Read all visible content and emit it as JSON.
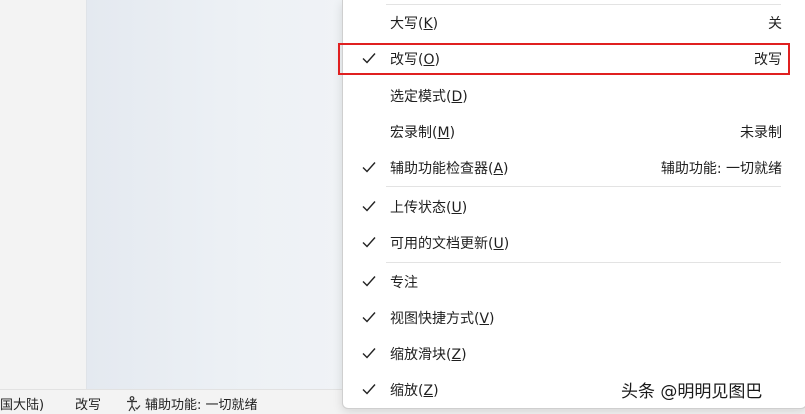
{
  "statusbar": {
    "language": "国大陆)",
    "overtype": "改写",
    "accessibility": "辅助功能: 一切就绪"
  },
  "menu": {
    "items": [
      {
        "key": "caps",
        "label": "大写(",
        "mnemonic": "K",
        "close": ")",
        "value": "关",
        "checked": false
      },
      {
        "key": "overtype",
        "label": "改写(",
        "mnemonic": "O",
        "close": ")",
        "value": "改写",
        "checked": true
      },
      {
        "key": "selection-mode",
        "label": "选定模式(",
        "mnemonic": "D",
        "close": ")",
        "value": "",
        "checked": false
      },
      {
        "key": "macro-recording",
        "label": "宏录制(",
        "mnemonic": "M",
        "close": ")",
        "value": "未录制",
        "checked": false
      },
      {
        "key": "accessibility-checker",
        "label": "辅助功能检查器(",
        "mnemonic": "A",
        "close": ")",
        "value": "辅助功能: 一切就绪",
        "checked": true
      },
      {
        "key": "upload-status",
        "label": "上传状态(",
        "mnemonic": "U",
        "close": ")",
        "value": "",
        "checked": true
      },
      {
        "key": "doc-updates",
        "label": "可用的文档更新(",
        "mnemonic": "U",
        "close": ")",
        "value": "",
        "checked": true
      },
      {
        "key": "focus",
        "label": "专注",
        "mnemonic": "",
        "close": "",
        "value": "",
        "checked": true
      },
      {
        "key": "view-shortcuts",
        "label": "视图快捷方式(",
        "mnemonic": "V",
        "close": ")",
        "value": "",
        "checked": true
      },
      {
        "key": "zoom-slider",
        "label": "缩放滑块(",
        "mnemonic": "Z",
        "close": ")",
        "value": "",
        "checked": true
      },
      {
        "key": "zoom",
        "label": "缩放(",
        "mnemonic": "Z",
        "close": ")",
        "value": "",
        "checked": true
      }
    ]
  },
  "watermark": "头条 @明明见图巴",
  "colors": {
    "highlight": "#e02020"
  }
}
